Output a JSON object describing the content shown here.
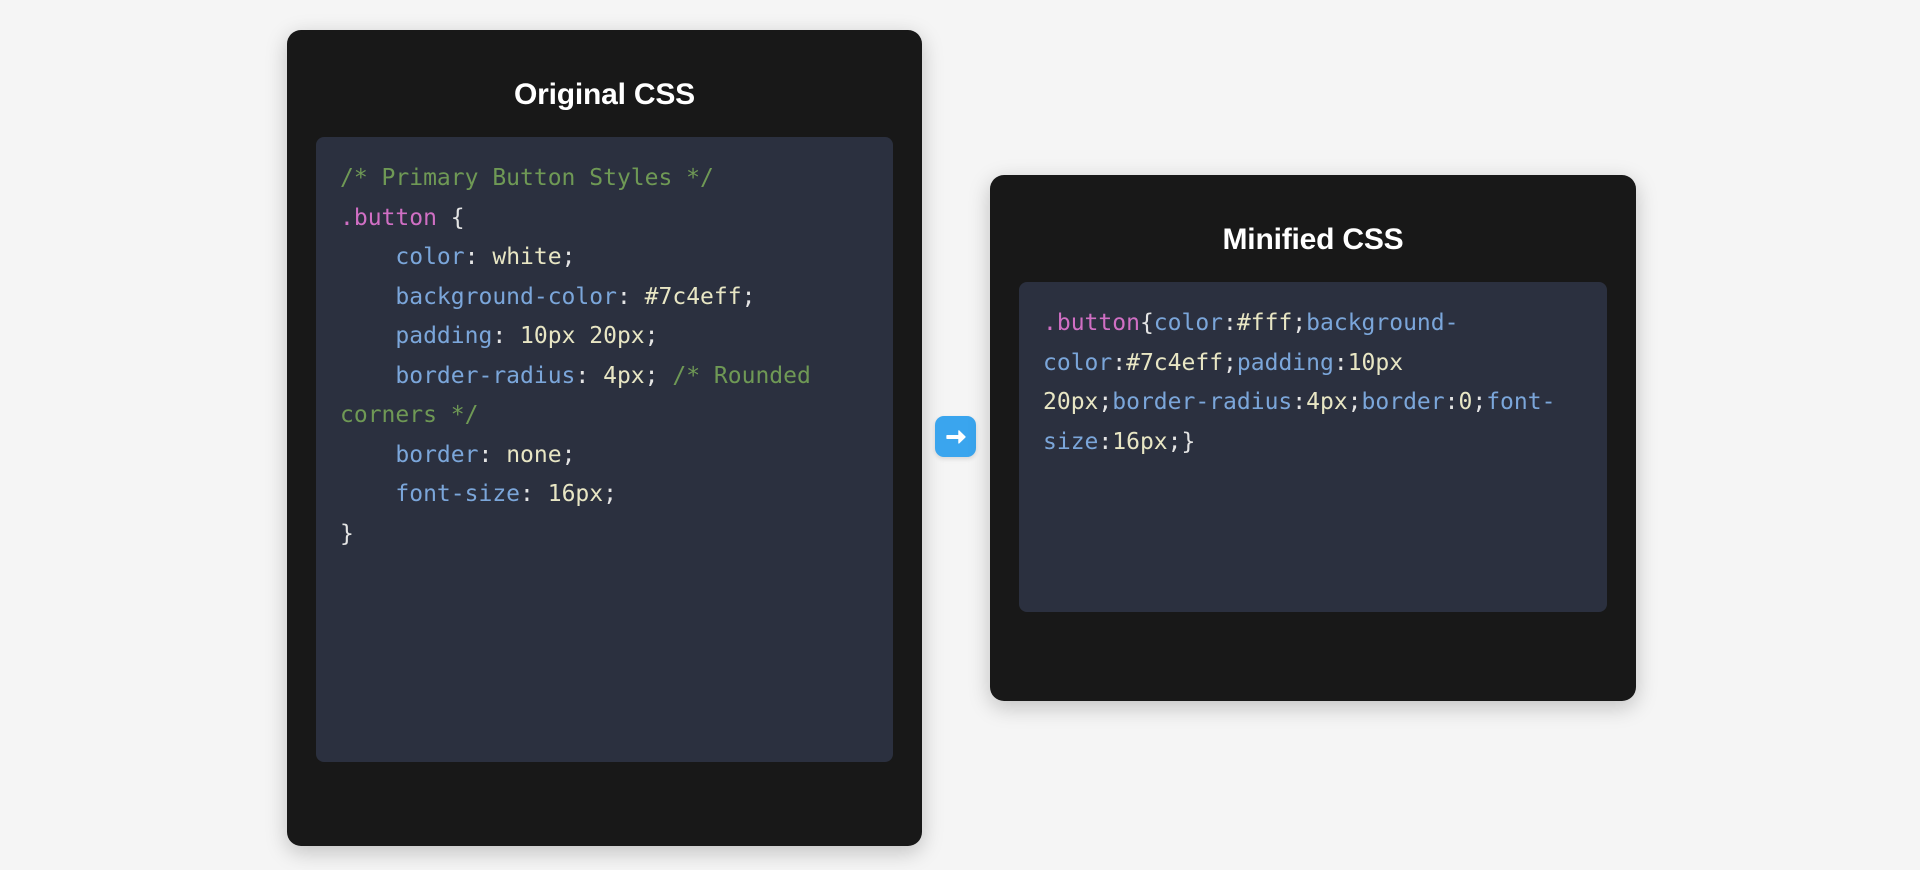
{
  "page": {
    "background_color": "#f5f5f5"
  },
  "original_panel": {
    "title": "Original CSS",
    "card_color": "#181818",
    "code_background": "#2b303f",
    "code_lines": [
      [
        {
          "text": "/* Primary Button Styles */",
          "token": "comment"
        }
      ],
      [
        {
          "text": ".button",
          "token": "selector"
        },
        {
          "text": " {",
          "token": "punct"
        }
      ],
      [
        {
          "text": "    ",
          "token": "punct"
        },
        {
          "text": "color",
          "token": "prop"
        },
        {
          "text": ": ",
          "token": "punct"
        },
        {
          "text": "white",
          "token": "value"
        },
        {
          "text": ";",
          "token": "punct"
        }
      ],
      [
        {
          "text": "    ",
          "token": "punct"
        },
        {
          "text": "background-color",
          "token": "prop"
        },
        {
          "text": ": ",
          "token": "punct"
        },
        {
          "text": "#7c4eff",
          "token": "value"
        },
        {
          "text": ";",
          "token": "punct"
        }
      ],
      [
        {
          "text": "    ",
          "token": "punct"
        },
        {
          "text": "padding",
          "token": "prop"
        },
        {
          "text": ": ",
          "token": "punct"
        },
        {
          "text": "10px 20px",
          "token": "value"
        },
        {
          "text": ";",
          "token": "punct"
        }
      ],
      [
        {
          "text": "    ",
          "token": "punct"
        },
        {
          "text": "border-radius",
          "token": "prop"
        },
        {
          "text": ": ",
          "token": "punct"
        },
        {
          "text": "4px",
          "token": "value"
        },
        {
          "text": "; ",
          "token": "punct"
        },
        {
          "text": "/* Rounded corners */",
          "token": "comment"
        }
      ],
      [
        {
          "text": "    ",
          "token": "punct"
        },
        {
          "text": "border",
          "token": "prop"
        },
        {
          "text": ": ",
          "token": "punct"
        },
        {
          "text": "none",
          "token": "value"
        },
        {
          "text": ";",
          "token": "punct"
        }
      ],
      [
        {
          "text": "    ",
          "token": "punct"
        },
        {
          "text": "font-size",
          "token": "prop"
        },
        {
          "text": ": ",
          "token": "punct"
        },
        {
          "text": "16px",
          "token": "value"
        },
        {
          "text": ";",
          "token": "punct"
        }
      ],
      [
        {
          "text": "}",
          "token": "punct"
        }
      ]
    ],
    "code_plain": "/* Primary Button Styles */\n.button {\n    color: white;\n    background-color: #7c4eff;\n    padding: 10px 20px;\n    border-radius: 4px; /* Rounded corners */\n    border: none;\n    font-size: 16px;\n}"
  },
  "minified_panel": {
    "title": "Minified CSS",
    "card_color": "#181818",
    "code_background": "#2b303f",
    "code_tokens": [
      {
        "text": ".button",
        "token": "selector"
      },
      {
        "text": "{",
        "token": "punct"
      },
      {
        "text": "color",
        "token": "prop"
      },
      {
        "text": ":",
        "token": "punct"
      },
      {
        "text": "#fff",
        "token": "value"
      },
      {
        "text": ";",
        "token": "punct"
      },
      {
        "text": "background-color",
        "token": "prop"
      },
      {
        "text": ":",
        "token": "punct"
      },
      {
        "text": "#7c4eff",
        "token": "value"
      },
      {
        "text": ";",
        "token": "punct"
      },
      {
        "text": "padding",
        "token": "prop"
      },
      {
        "text": ":",
        "token": "punct"
      },
      {
        "text": "10px 20px",
        "token": "value"
      },
      {
        "text": ";",
        "token": "punct"
      },
      {
        "text": "border-radius",
        "token": "prop"
      },
      {
        "text": ":",
        "token": "punct"
      },
      {
        "text": "4px",
        "token": "value"
      },
      {
        "text": ";",
        "token": "punct"
      },
      {
        "text": "border",
        "token": "prop"
      },
      {
        "text": ":",
        "token": "punct"
      },
      {
        "text": "0",
        "token": "value"
      },
      {
        "text": ";",
        "token": "punct"
      },
      {
        "text": "font-size",
        "token": "prop"
      },
      {
        "text": ":",
        "token": "punct"
      },
      {
        "text": "16px",
        "token": "value"
      },
      {
        "text": ";",
        "token": "punct"
      },
      {
        "text": "}",
        "token": "punct"
      }
    ],
    "code_plain": ".button{color:#fff;background-color:#7c4eff;padding:10px 20px;border-radius:4px;border:0;font-size:16px;}"
  },
  "transform_arrow": {
    "icon": "arrow-right-icon",
    "color": "#3aa5ee",
    "glyph_color": "#ffffff"
  },
  "syntax_colors": {
    "comment": "#6f9955",
    "selector": "#d06fc4",
    "property": "#7ba6da",
    "value": "#e8e6c4",
    "punctuation": "#e4e4e4"
  }
}
